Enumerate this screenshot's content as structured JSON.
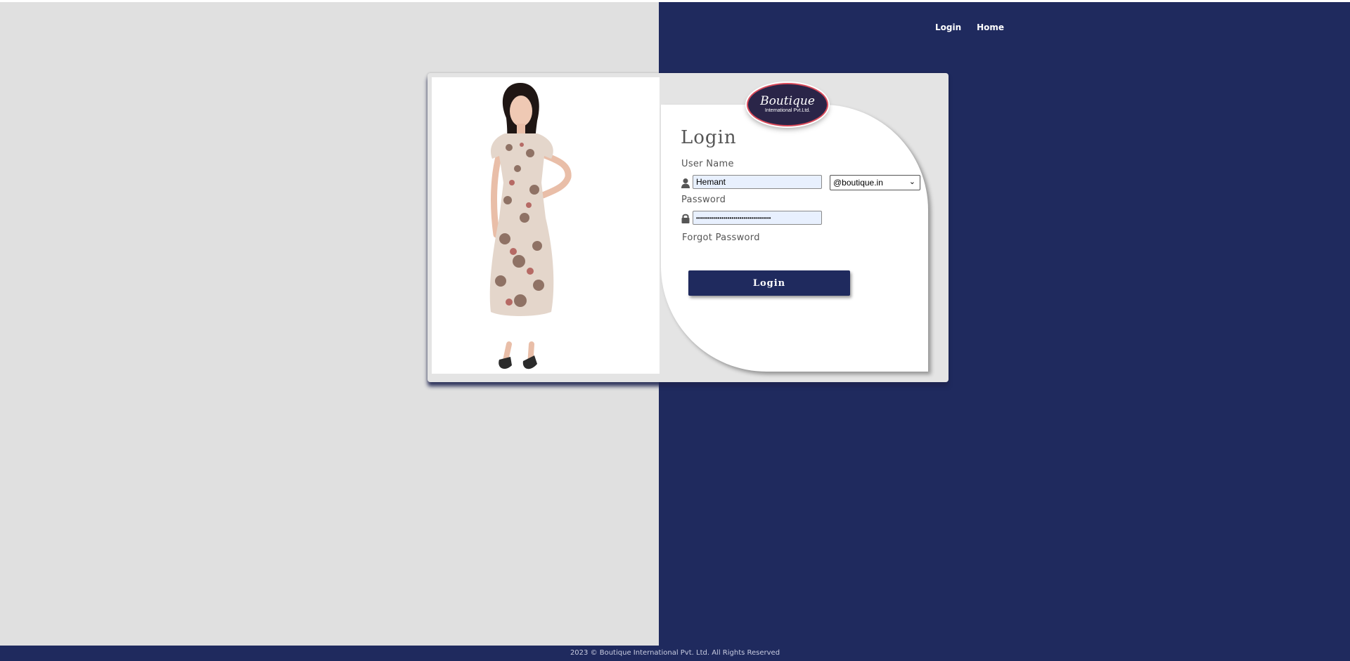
{
  "nav": {
    "login": "Login",
    "home": "Home"
  },
  "logo": {
    "title": "Boutique",
    "subtitle": "International Pvt.Ltd."
  },
  "form": {
    "title": "Login",
    "username_label": "User Name",
    "username_value": "Hemant",
    "domain_selected": "@boutique.in",
    "password_label": "Password",
    "password_value": "••••••••••••••••••••••••••••••••••••••",
    "forgot_label": "Forgot Password",
    "submit_label": "Login"
  },
  "footer": {
    "text": "2023 © Boutique International Pvt. Ltd. All Rights Reserved"
  },
  "colors": {
    "navy": "#1f2a5e",
    "light_gray": "#e0e0e0",
    "input_fill": "#e8f0fe"
  },
  "icons": {
    "username": "user-icon",
    "password": "lock-icon",
    "dropdown": "chevron-down-icon"
  }
}
